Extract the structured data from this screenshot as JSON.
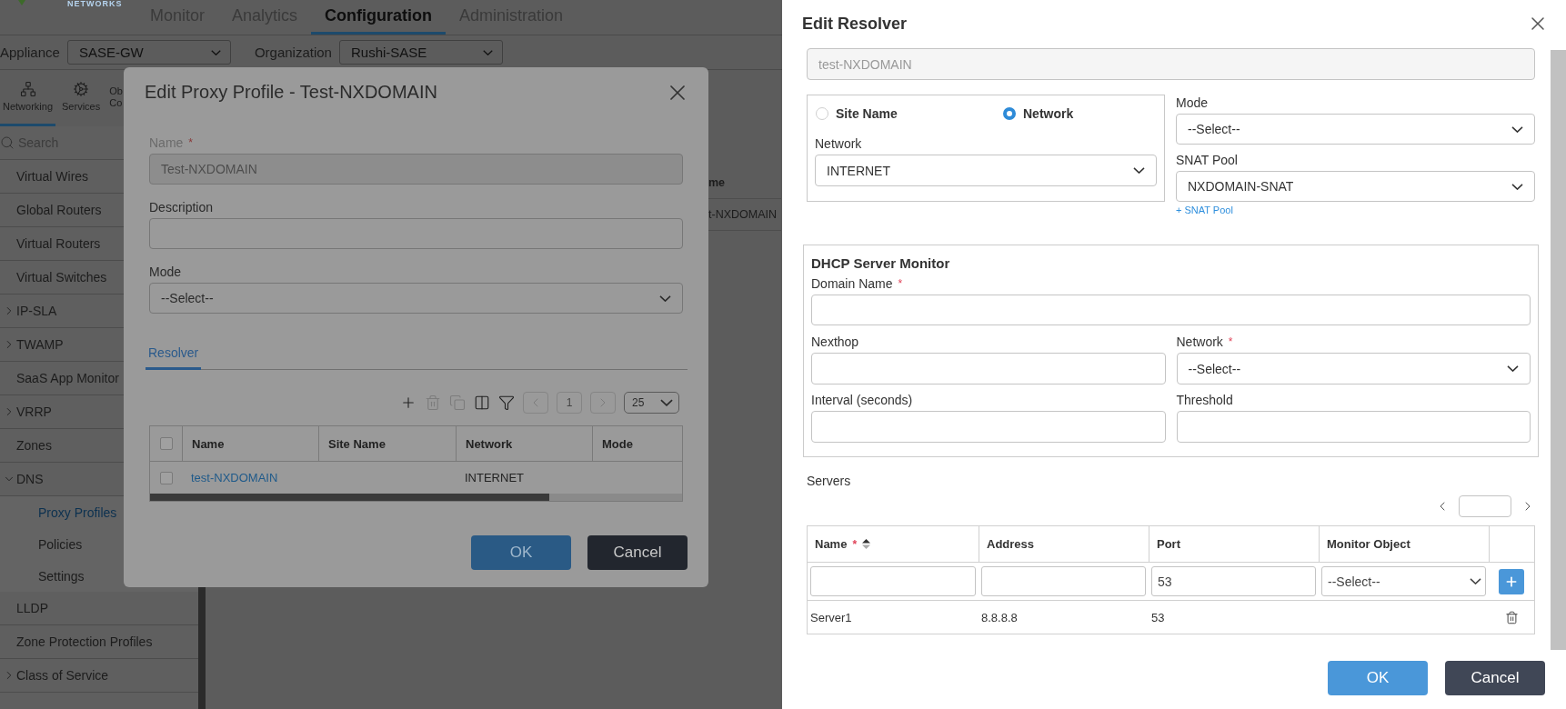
{
  "header": {
    "logo_text": "NETWORKS",
    "nav": [
      {
        "label": "Monitor",
        "selected": false
      },
      {
        "label": "Analytics",
        "selected": false
      },
      {
        "label": "Configuration",
        "selected": true
      },
      {
        "label": "Administration",
        "selected": false
      }
    ]
  },
  "context": [
    {
      "label": "Appliance",
      "value": "SASE-GW"
    },
    {
      "label": "Organization",
      "value": "Rushi-SASE"
    }
  ],
  "icon_tabs": [
    {
      "kind": "networking",
      "lines": [
        "Networking"
      ],
      "selected": true
    },
    {
      "kind": "services",
      "lines": [
        "Services"
      ],
      "selected": false
    },
    {
      "kind": "hidden",
      "lines": [
        "Ob",
        "Co"
      ],
      "selected": false
    }
  ],
  "sidebar": {
    "search_placeholder": "Search",
    "items": [
      {
        "label": "Virtual Wires",
        "selected": false
      },
      {
        "label": "Global Routers",
        "selected": false
      },
      {
        "label": "Virtual Routers",
        "selected": false
      },
      {
        "label": "Virtual Switches",
        "selected": false
      },
      {
        "label": "IP-SLA",
        "selected": false,
        "expanded": false
      },
      {
        "label": "TWAMP",
        "selected": false,
        "expanded": false
      },
      {
        "label": "SaaS App Monitor",
        "selected": false
      },
      {
        "label": "VRRP",
        "selected": false,
        "expanded": false
      },
      {
        "label": "Zones",
        "selected": false
      },
      {
        "label": "DNS",
        "selected": false,
        "expanded": true,
        "children": [
          {
            "label": "Proxy Profiles",
            "selected": true
          },
          {
            "label": "Policies",
            "selected": false
          },
          {
            "label": "Settings",
            "selected": false
          }
        ]
      },
      {
        "label": "LLDP",
        "selected": false
      },
      {
        "label": "Zone Protection Profiles",
        "selected": false
      },
      {
        "label": "Class of Service",
        "selected": false,
        "expanded": false
      }
    ]
  },
  "background_table": {
    "header": "me",
    "cell": "t-NXDOMAIN"
  },
  "proxy_modal": {
    "title": "Edit Proxy Profile - Test-NXDOMAIN",
    "fields": [
      {
        "kind": "input",
        "label": "Name",
        "required_mark": "*",
        "value": "Test-NXDOMAIN",
        "disabled": true
      },
      {
        "kind": "input",
        "label": "Description",
        "disabled": false
      },
      {
        "kind": "select",
        "label": "Mode",
        "value": "--Select--"
      }
    ],
    "tabs": [
      {
        "label": "Resolver",
        "selected": true
      }
    ],
    "tools": [
      {
        "kind": "add",
        "disabled": false
      },
      {
        "kind": "delete",
        "disabled": true
      },
      {
        "kind": "copy",
        "disabled": true
      },
      {
        "kind": "columns",
        "disabled": false
      },
      {
        "kind": "filter",
        "disabled": false
      }
    ],
    "pager": {
      "page": "1",
      "page_size": "25"
    },
    "table": {
      "header_checked": false,
      "columns": [
        "Name",
        "Site Name",
        "Network",
        "Mode"
      ],
      "rows": [
        {
          "checked": false,
          "name": "test-NXDOMAIN",
          "network": "INTERNET"
        }
      ]
    },
    "buttons": [
      {
        "kind": "primary",
        "label": "OK"
      },
      {
        "kind": "secondary",
        "label": "Cancel"
      }
    ]
  },
  "resolver_panel": {
    "title": "Edit Resolver",
    "name_value": "test-NXDOMAIN",
    "target_options": [
      {
        "label": "Site Name",
        "selected": false
      },
      {
        "label": "Network",
        "selected": true
      }
    ],
    "network": {
      "label": "Network",
      "value": "INTERNET"
    },
    "mode": {
      "label": "Mode",
      "value": "--Select--"
    },
    "snat_pool": {
      "label": "SNAT Pool",
      "value": "NXDOMAIN-SNAT",
      "add_link": "+ SNAT Pool"
    },
    "monitor": {
      "title": "DHCP Server Monitor",
      "domain_name": {
        "label": "Domain Name",
        "required_mark": "*"
      },
      "nexthop": {
        "label": "Nexthop"
      },
      "network": {
        "label": "Network",
        "required_mark": "*",
        "value": "--Select--"
      },
      "interval": {
        "label": "Interval (seconds)"
      },
      "threshold": {
        "label": "Threshold"
      }
    },
    "servers": {
      "label": "Servers",
      "columns": [
        {
          "label": "Name",
          "required_mark": "*",
          "sortable": true
        },
        {
          "label": "Address"
        },
        {
          "label": "Port"
        },
        {
          "label": "Monitor Object"
        }
      ],
      "new_row": {
        "port": "53",
        "monitor_object": "--Select--"
      },
      "rows": [
        {
          "name": "Server1",
          "address": "8.8.8.8",
          "port": "53"
        }
      ]
    },
    "buttons": [
      {
        "kind": "primary",
        "label": "OK"
      },
      {
        "kind": "secondary",
        "label": "Cancel"
      }
    ]
  }
}
